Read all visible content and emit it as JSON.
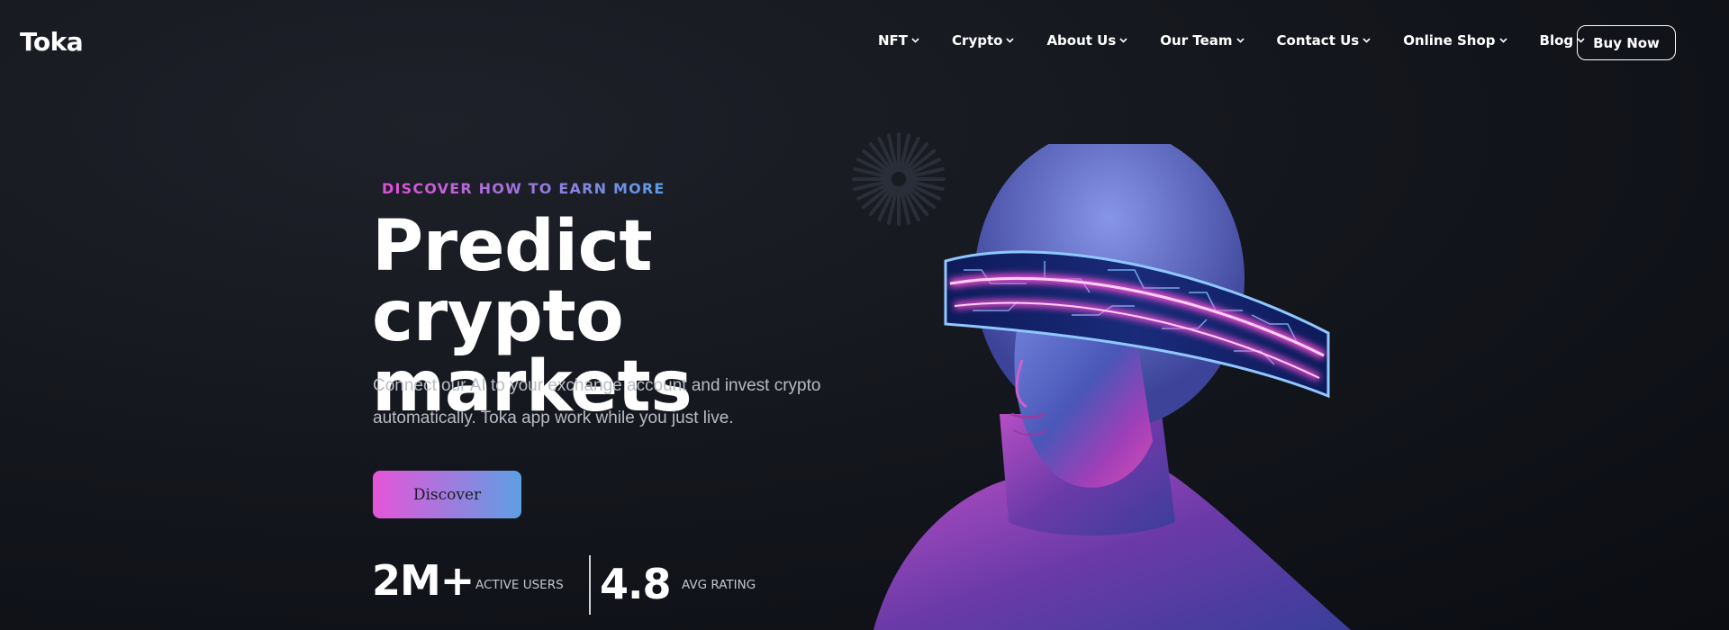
{
  "header": {
    "logo": "Toka",
    "nav": [
      {
        "label": "NFT"
      },
      {
        "label": "Crypto"
      },
      {
        "label": "About Us"
      },
      {
        "label": "Our Team"
      },
      {
        "label": "Contact Us"
      },
      {
        "label": "Online Shop"
      },
      {
        "label": "Blog"
      }
    ],
    "buy_label": "Buy Now"
  },
  "hero": {
    "eyebrow": "DISCOVER HOW TO EARN MORE",
    "title_line1": "Predict crypto",
    "title_line2": "markets",
    "description": "Connect our AI to your exchange account and invest crypto automatically. Toka app work while you just live.",
    "cta_label": "Discover"
  },
  "stats": [
    {
      "value": "2M+",
      "label": "ACTIVE USERS"
    },
    {
      "value": "4.8",
      "label": "AVG RATING"
    }
  ],
  "icons": {
    "nav_dropdown": "chevron-down-icon",
    "decoration": "radial-burst-icon",
    "hero_image": "visor-head-illustration"
  },
  "colors": {
    "background": "#15171e",
    "accent_pink": "#e555d8",
    "accent_blue": "#5e9fe3",
    "text_muted": "#b9bcc4"
  }
}
